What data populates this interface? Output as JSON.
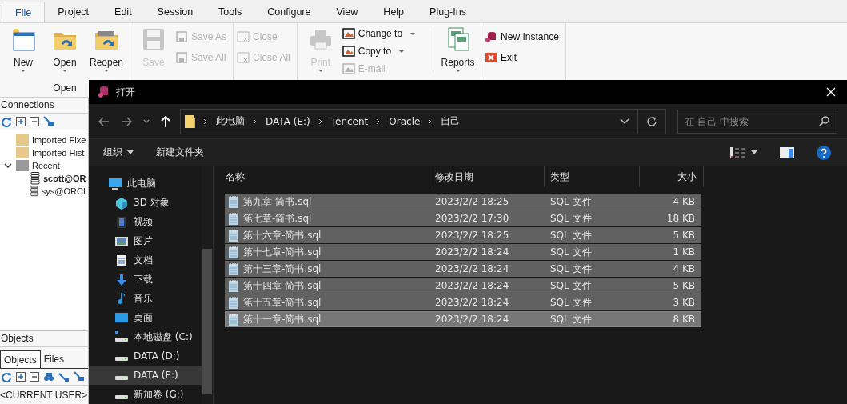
{
  "menu_tabs": [
    {
      "label": "File",
      "selected": true
    },
    {
      "label": "Project",
      "selected": false
    },
    {
      "label": "Edit",
      "selected": false
    },
    {
      "label": "Session",
      "selected": false
    },
    {
      "label": "Tools",
      "selected": false
    },
    {
      "label": "Configure",
      "selected": false
    },
    {
      "label": "View",
      "selected": false
    },
    {
      "label": "Help",
      "selected": false
    },
    {
      "label": "Plug-Ins",
      "selected": false
    }
  ],
  "ribbon": {
    "open_group": {
      "label": "Open",
      "buttons": [
        {
          "label": "New"
        },
        {
          "label": "Open"
        },
        {
          "label": "Reopen"
        }
      ]
    },
    "save_group": {
      "large": {
        "label": "Save",
        "disabled": true
      },
      "small": [
        {
          "label": "Save As",
          "disabled": true
        },
        {
          "label": "Save All",
          "disabled": true
        }
      ]
    },
    "close_group": {
      "small": [
        {
          "label": "Close",
          "disabled": true
        },
        {
          "label": "Close All",
          "disabled": true
        }
      ]
    },
    "print_group": {
      "large": {
        "label": "Print",
        "disabled": true
      },
      "small": [
        {
          "label": "Change to",
          "disabled": false
        },
        {
          "label": "Copy to",
          "disabled": false
        },
        {
          "label": "E-mail",
          "disabled": true
        }
      ]
    },
    "reports": {
      "label": "Reports"
    },
    "instance_group": {
      "small": [
        {
          "label": "New Instance"
        },
        {
          "label": "Exit"
        }
      ]
    }
  },
  "connections": {
    "title": "Connections",
    "tree": [
      {
        "label": "Imported Fixe",
        "color": "#e8c888"
      },
      {
        "label": "Imported Hist",
        "color": "#e8c888"
      },
      {
        "label": "Recent",
        "color": "#9a9a9a",
        "expanded": true,
        "children": [
          {
            "label": "scott@OR",
            "active": true
          },
          {
            "label": "sys@ORCL",
            "active": false
          }
        ]
      }
    ]
  },
  "objects": {
    "title": "Objects",
    "tabs": [
      {
        "label": "Objects",
        "selected": true
      },
      {
        "label": "Files",
        "selected": false
      }
    ],
    "schema": "<CURRENT USER>"
  },
  "dialog": {
    "title": "打开",
    "path": [
      "此电脑",
      "DATA (E:)",
      "Tencent",
      "Oracle",
      "自己"
    ],
    "search": {
      "placeholder": "在 自己 中搜索"
    },
    "organize": "组织",
    "new_folder": "新建文件夹",
    "nav": [
      {
        "label": "此电脑",
        "kind": "pc",
        "selected": false
      },
      {
        "label": "3D 对象",
        "kind": "cube",
        "selected": false
      },
      {
        "label": "视频",
        "kind": "video",
        "selected": false
      },
      {
        "label": "图片",
        "kind": "pictures",
        "selected": false
      },
      {
        "label": "文档",
        "kind": "document",
        "selected": false
      },
      {
        "label": "下载",
        "kind": "download",
        "selected": false
      },
      {
        "label": "音乐",
        "kind": "music",
        "selected": false
      },
      {
        "label": "桌面",
        "kind": "desktop",
        "selected": false
      },
      {
        "label": "本地磁盘 (C:)",
        "kind": "system-drive",
        "selected": false
      },
      {
        "label": "DATA (D:)",
        "kind": "drive",
        "selected": false
      },
      {
        "label": "DATA (E:)",
        "kind": "drive",
        "selected": true
      },
      {
        "label": "新加卷 (G:)",
        "kind": "drive",
        "selected": false
      }
    ],
    "columns": [
      "名称",
      "修改日期",
      "类型",
      "大小"
    ],
    "files": [
      {
        "name": "第九章-简书.sql",
        "modified": "2023/2/2 18:25",
        "type": "SQL 文件",
        "size": "4 KB",
        "selected": true,
        "focused": false
      },
      {
        "name": "第七章-简书.sql",
        "modified": "2023/2/2 17:30",
        "type": "SQL 文件",
        "size": "18 KB",
        "selected": true,
        "focused": false
      },
      {
        "name": "第十六章-简书.sql",
        "modified": "2023/2/2 18:25",
        "type": "SQL 文件",
        "size": "5 KB",
        "selected": true,
        "focused": false
      },
      {
        "name": "第十七章-简书.sql",
        "modified": "2023/2/2 18:24",
        "type": "SQL 文件",
        "size": "1 KB",
        "selected": true,
        "focused": false
      },
      {
        "name": "第十三章-简书.sql",
        "modified": "2023/2/2 18:24",
        "type": "SQL 文件",
        "size": "4 KB",
        "selected": true,
        "focused": false
      },
      {
        "name": "第十四章-简书.sql",
        "modified": "2023/2/2 18:24",
        "type": "SQL 文件",
        "size": "5 KB",
        "selected": true,
        "focused": false
      },
      {
        "name": "第十五章-简书.sql",
        "modified": "2023/2/2 18:24",
        "type": "SQL 文件",
        "size": "3 KB",
        "selected": true,
        "focused": false
      },
      {
        "name": "第十一章-简书.sql",
        "modified": "2023/2/2 18:24",
        "type": "SQL 文件",
        "size": "8 KB",
        "selected": true,
        "focused": true
      }
    ]
  }
}
